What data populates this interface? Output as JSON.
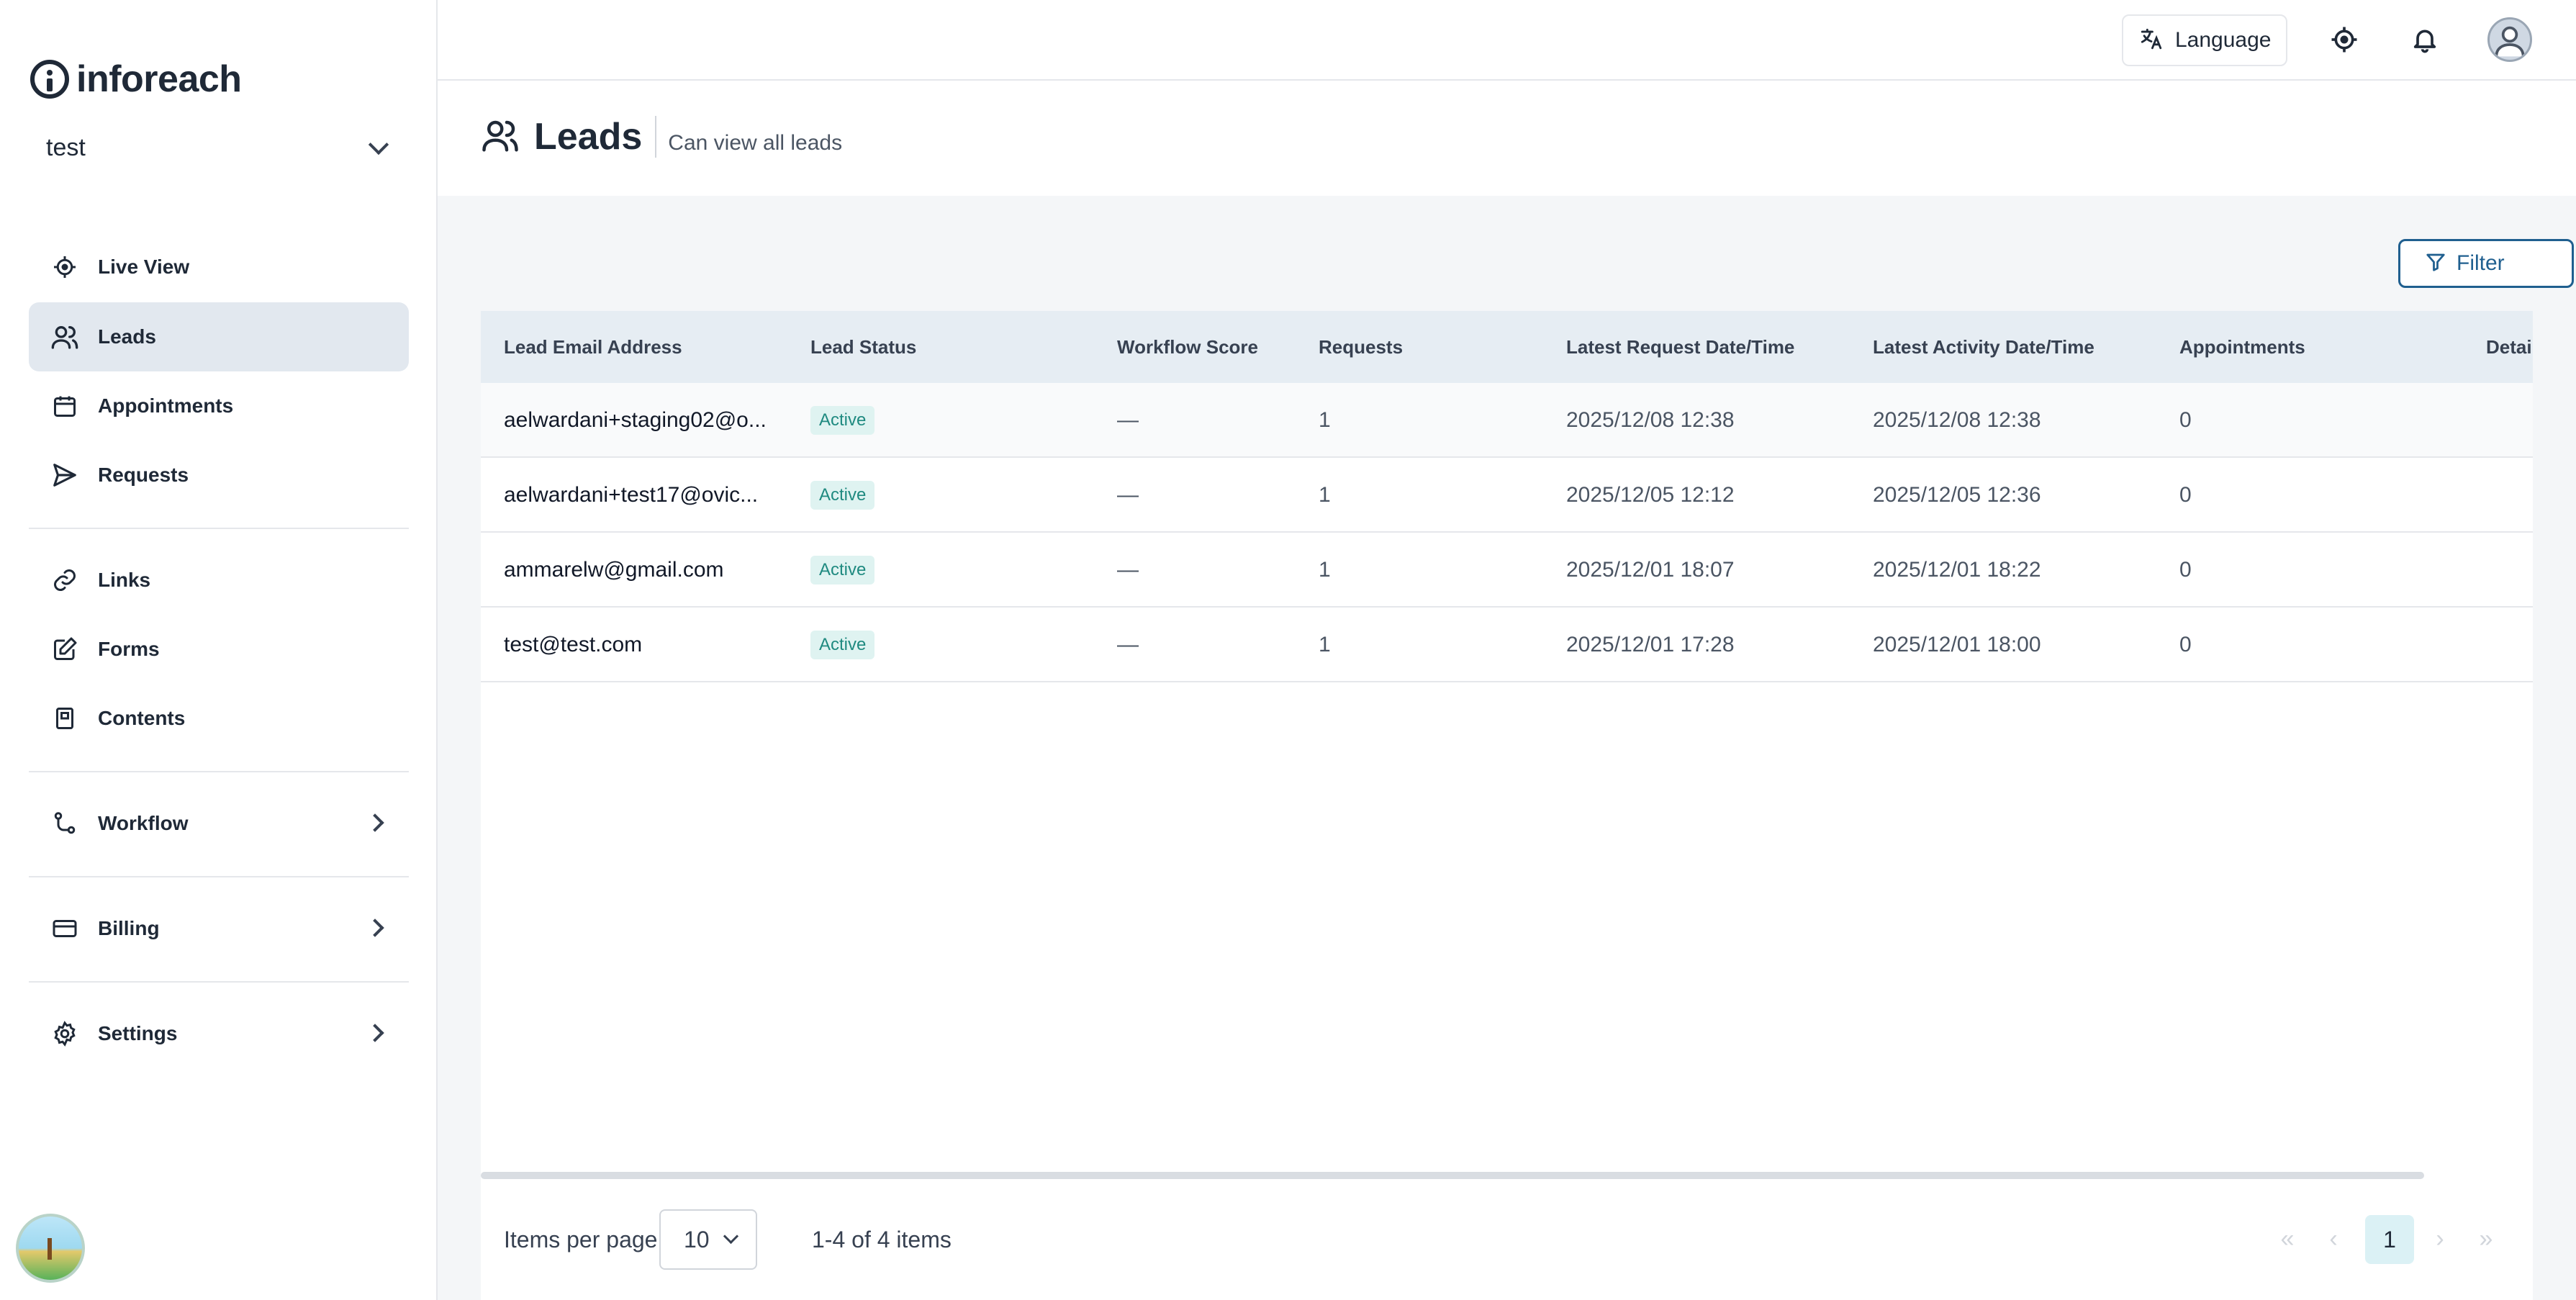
{
  "app": {
    "logo_text": "inforeach"
  },
  "org": {
    "name": "test"
  },
  "sidebar": {
    "items": [
      {
        "label": "Live View"
      },
      {
        "label": "Leads"
      },
      {
        "label": "Appointments"
      },
      {
        "label": "Requests"
      },
      {
        "label": "Links"
      },
      {
        "label": "Forms"
      },
      {
        "label": "Contents"
      },
      {
        "label": "Workflow"
      },
      {
        "label": "Billing"
      },
      {
        "label": "Settings"
      }
    ]
  },
  "topbar": {
    "language_label": "Language"
  },
  "page": {
    "title": "Leads",
    "subtitle": "Can view all leads"
  },
  "toolbar": {
    "filter_label": "Filter"
  },
  "table": {
    "columns": [
      "Lead Email Address",
      "Lead Status",
      "Workflow Score",
      "Requests",
      "Latest Request Date/Time",
      "Latest Activity Date/Time",
      "Appointments",
      "Detai"
    ],
    "rows": [
      {
        "email": "aelwardani+staging02@o...",
        "status": "Active",
        "score": "—",
        "requests": "1",
        "latest_request": "2025/12/08 12:38",
        "latest_activity": "2025/12/08 12:38",
        "appointments": "0"
      },
      {
        "email": "aelwardani+test17@ovic...",
        "status": "Active",
        "score": "—",
        "requests": "1",
        "latest_request": "2025/12/05 12:12",
        "latest_activity": "2025/12/05 12:36",
        "appointments": "0"
      },
      {
        "email": "ammarelw@gmail.com",
        "status": "Active",
        "score": "—",
        "requests": "1",
        "latest_request": "2025/12/01 18:07",
        "latest_activity": "2025/12/01 18:22",
        "appointments": "0"
      },
      {
        "email": "test@test.com",
        "status": "Active",
        "score": "—",
        "requests": "1",
        "latest_request": "2025/12/01 17:28",
        "latest_activity": "2025/12/01 18:00",
        "appointments": "0"
      }
    ]
  },
  "pagination": {
    "items_per_page_label": "Items per page",
    "items_per_page": "10",
    "range_text": "1-4 of 4 items",
    "current_page": "1"
  },
  "colors": {
    "active_nav_bg": "#e2e8ef",
    "status_badge_bg": "#dff3f1",
    "status_badge_text": "#1f8a80",
    "filter_accent": "#1f5f8f"
  },
  "icons": [
    "live-view-icon",
    "users-icon",
    "calendar-icon",
    "send-icon",
    "link-icon",
    "edit-icon",
    "book-icon",
    "workflow-icon",
    "credit-card-icon",
    "gear-icon",
    "translate-icon",
    "location-icon",
    "bell-icon",
    "user-avatar-icon",
    "filter-icon"
  ]
}
